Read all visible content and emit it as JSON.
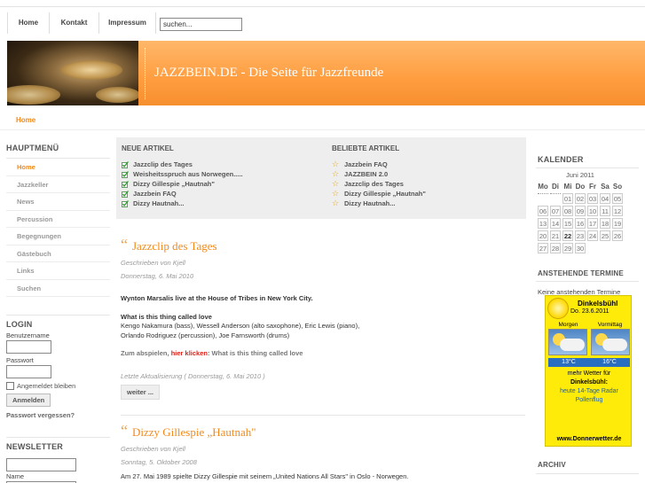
{
  "nav": {
    "items": [
      "Home",
      "Kontakt",
      "Impressum"
    ],
    "search_value": "suchen..."
  },
  "banner": {
    "title": "JAZZBEIN.DE - Die Seite für Jazzfreunde"
  },
  "breadcrumb": "Home",
  "left": {
    "menu_title": "HAUPTMENÜ",
    "menu": [
      "Home",
      "Jazzkeller",
      "News",
      "Percussion",
      "Begegnungen",
      "Gästebuch",
      "Links",
      "Suchen"
    ],
    "active_menu": "Home",
    "login_title": "LOGIN",
    "username_label": "Benutzername",
    "password_label": "Passwort",
    "remember_label": "Angemeldet bleiben",
    "login_button": "Anmelden",
    "forgot_link": "Passwort vergessen?",
    "newsletter_title": "NEWSLETTER",
    "newsletter_name_label": "Name"
  },
  "articles_box": {
    "new_title": "NEUE ARTIKEL",
    "new": [
      "Jazzclip des Tages",
      "Weisheitsspruch aus Norwegen.....",
      "Dizzy Gillespie „Hautnah\"",
      "Jazzbein FAQ",
      "Dizzy Hautnah..."
    ],
    "popular_title": "BELIEBTE ARTIKEL",
    "popular": [
      "Jazzbein FAQ",
      "JAZZBEIN 2.0",
      "Jazzclip des Tages",
      "Dizzy Gillespie „Hautnah\"",
      "Dizzy Hautnah..."
    ]
  },
  "article1": {
    "title": "Jazzclip des Tages",
    "author": "Geschrieben von Kjell",
    "date": "Donnerstag, 6. Mai 2010",
    "intro": "Wynton Marsalis live at the House of Tribes in New York City.",
    "subtitle": "What is this thing called love",
    "line1": "Kengo Nakamura (bass), Wessell Anderson (alto saxophone), Eric Lewis (piano),",
    "line2": "Orlando Rodriguez (percussion), Joe Farnsworth (drums)",
    "play_prefix": "Zum abspielen, ",
    "play_link": "hier klicken",
    "play_suffix": ": What is this thing called love",
    "updated": "Letzte Aktualisierung ( Donnerstag, 6. Mai 2010 )",
    "more": "weiter ..."
  },
  "article2": {
    "title": "Dizzy Gillespie „Hautnah\"",
    "author": "Geschrieben von Kjell",
    "date": "Sonntag, 5. Oktober 2008",
    "intro": "Am 27. Mai 1989 spielte Dizzy Gillespie mit seinem „United Nations All Stars\" in Oslo - Norwegen."
  },
  "right": {
    "calendar_title": "KALENDER",
    "calendar_month": "Juni 2011",
    "weekdays": [
      "Mo",
      "Di",
      "Mi",
      "Do",
      "Fr",
      "Sa",
      "So"
    ],
    "weeks": [
      [
        "",
        "",
        "01",
        "02",
        "03",
        "04",
        "05"
      ],
      [
        "06",
        "07",
        "08",
        "09",
        "10",
        "11",
        "12"
      ],
      [
        "13",
        "14",
        "15",
        "16",
        "17",
        "18",
        "19"
      ],
      [
        "20",
        "21",
        "22",
        "23",
        "24",
        "25",
        "26"
      ],
      [
        "27",
        "28",
        "29",
        "30",
        "",
        "",
        ""
      ]
    ],
    "today": "22",
    "events_title": "ANSTEHENDE TERMINE",
    "events_text": "Keine anstehenden Termine",
    "archive_title": "ARCHIV"
  },
  "weather": {
    "city": "Dinkelsbühl",
    "date": "Do. 23.6.2011",
    "day1": "Morgen",
    "day2": "Vormittag",
    "temp1": "13°C",
    "temp2": "16°C",
    "text1": "mehr Wetter für",
    "text2": "Dinkelsbühl:",
    "text3": "heute 14-Tage Radar",
    "text4": "Pollenflug",
    "url": "www.Donnerwetter.de"
  }
}
